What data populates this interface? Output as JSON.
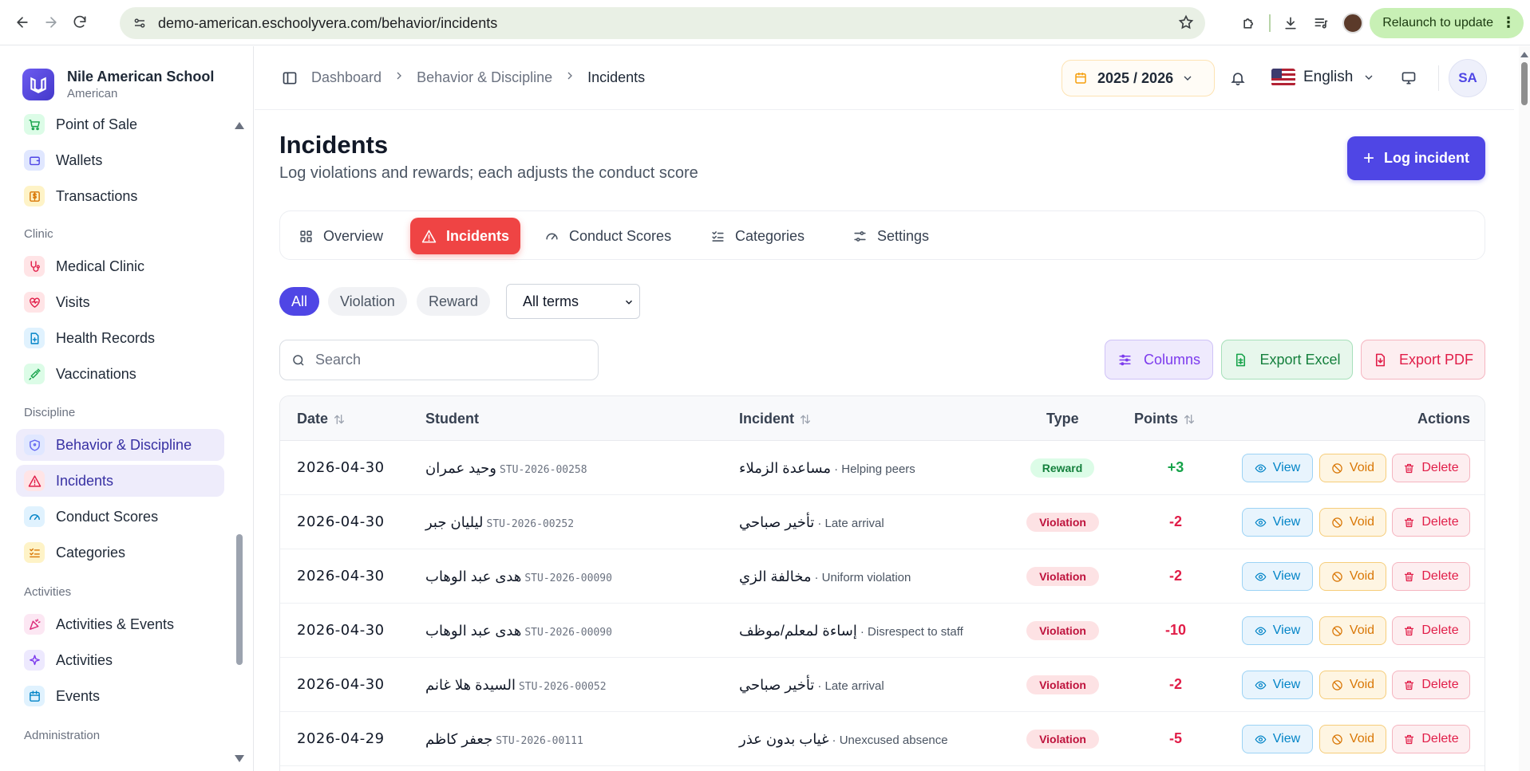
{
  "browser": {
    "url": "demo-american.eschoolyvera.com/behavior/incidents",
    "relaunch_label": "Relaunch to update"
  },
  "brand": {
    "name": "Nile American School",
    "subtitle": "American"
  },
  "sidebar": {
    "items": [
      {
        "label": "Point of Sale",
        "icon": "cart-icon",
        "color": "#16a34a",
        "bg": "#dcfce7"
      },
      {
        "label": "Wallets",
        "icon": "wallet-icon",
        "color": "#4f46e5",
        "bg": "#e0e7ff"
      },
      {
        "label": "Transactions",
        "icon": "dollar-icon",
        "color": "#d97706",
        "bg": "#fef3c7"
      },
      {
        "label": "Medical Clinic",
        "icon": "stethoscope-icon",
        "color": "#e11d48",
        "bg": "#ffe4e6"
      },
      {
        "label": "Visits",
        "icon": "heart-pulse-icon",
        "color": "#e11d48",
        "bg": "#ffe4e6"
      },
      {
        "label": "Health Records",
        "icon": "file-medical-icon",
        "color": "#0284c7",
        "bg": "#e0f2fe"
      },
      {
        "label": "Vaccinations",
        "icon": "syringe-icon",
        "color": "#16a34a",
        "bg": "#dcfce7"
      },
      {
        "label": "Behavior & Discipline",
        "icon": "shield-icon",
        "color": "#6366f1",
        "bg": "#e0e7ff",
        "active": true
      },
      {
        "label": "Incidents",
        "icon": "warning-icon",
        "color": "#e11d48",
        "bg": "#ffe4e6",
        "active": true
      },
      {
        "label": "Conduct Scores",
        "icon": "gauge-icon",
        "color": "#0284c7",
        "bg": "#e0f2fe"
      },
      {
        "label": "Categories",
        "icon": "list-check-icon",
        "color": "#d97706",
        "bg": "#fef3c7"
      },
      {
        "label": "Activities & Events",
        "icon": "party-icon",
        "color": "#db2777",
        "bg": "#fce7f3"
      },
      {
        "label": "Activities",
        "icon": "sparkles-icon",
        "color": "#7c3aed",
        "bg": "#ede9fe"
      },
      {
        "label": "Events",
        "icon": "calendar-icon",
        "color": "#0284c7",
        "bg": "#e0f2fe"
      }
    ],
    "groups": [
      "Clinic",
      "Discipline",
      "Activities",
      "Administration"
    ]
  },
  "topbar": {
    "breadcrumb": [
      "Dashboard",
      "Behavior & Discipline",
      "Incidents"
    ],
    "year": "2025 / 2026",
    "language": "English",
    "avatar_initials": "SA"
  },
  "page": {
    "title": "Incidents",
    "subtitle": "Log violations and rewards; each adjusts the conduct score",
    "log_button": "Log incident"
  },
  "tabs": [
    {
      "label": "Overview",
      "icon": "grid-icon"
    },
    {
      "label": "Incidents",
      "icon": "warning-icon",
      "active": true
    },
    {
      "label": "Conduct Scores",
      "icon": "gauge-icon"
    },
    {
      "label": "Categories",
      "icon": "list-check-icon"
    },
    {
      "label": "Settings",
      "icon": "sliders-icon"
    }
  ],
  "filters": {
    "chips": [
      "All",
      "Violation",
      "Reward"
    ],
    "term_select": "All terms"
  },
  "search": {
    "placeholder": "Search"
  },
  "toolbar": {
    "columns": "Columns",
    "export_excel": "Export Excel",
    "export_pdf": "Export PDF"
  },
  "table": {
    "columns": {
      "date": "Date",
      "student": "Student",
      "incident": "Incident",
      "type": "Type",
      "points": "Points",
      "actions": "Actions"
    },
    "action_labels": {
      "view": "View",
      "void": "Void",
      "delete": "Delete"
    },
    "rows": [
      {
        "date": "2026-04-30",
        "student": "وحيد عمران",
        "code": "STU-2026-00258",
        "incident_ar": "مساعدة الزملاء",
        "incident_en": "· Helping peers",
        "type": "Reward",
        "points": "+3"
      },
      {
        "date": "2026-04-30",
        "student": "ليليان جبر",
        "code": "STU-2026-00252",
        "incident_ar": "تأخير صباحي",
        "incident_en": "· Late arrival",
        "type": "Violation",
        "points": "-2"
      },
      {
        "date": "2026-04-30",
        "student": "هدى عبد الوهاب",
        "code": "STU-2026-00090",
        "incident_ar": "مخالفة الزي",
        "incident_en": "· Uniform violation",
        "type": "Violation",
        "points": "-2"
      },
      {
        "date": "2026-04-30",
        "student": "هدى عبد الوهاب",
        "code": "STU-2026-00090",
        "incident_ar": "إساءة لمعلم/موظف",
        "incident_en": "· Disrespect to staff",
        "type": "Violation",
        "points": "-10"
      },
      {
        "date": "2026-04-30",
        "student": "السيدة هلا غانم",
        "code": "STU-2026-00052",
        "incident_ar": "تأخير صباحي",
        "incident_en": "· Late arrival",
        "type": "Violation",
        "points": "-2"
      },
      {
        "date": "2026-04-29",
        "student": "جعفر كاظم",
        "code": "STU-2026-00111",
        "incident_ar": "غياب بدون عذر",
        "incident_en": "· Unexcused absence",
        "type": "Violation",
        "points": "-5"
      }
    ]
  },
  "colors": {
    "primary": "#4f46e5",
    "danger": "#ef4444",
    "reward": "#16a34a",
    "violation": "#e11d48"
  }
}
